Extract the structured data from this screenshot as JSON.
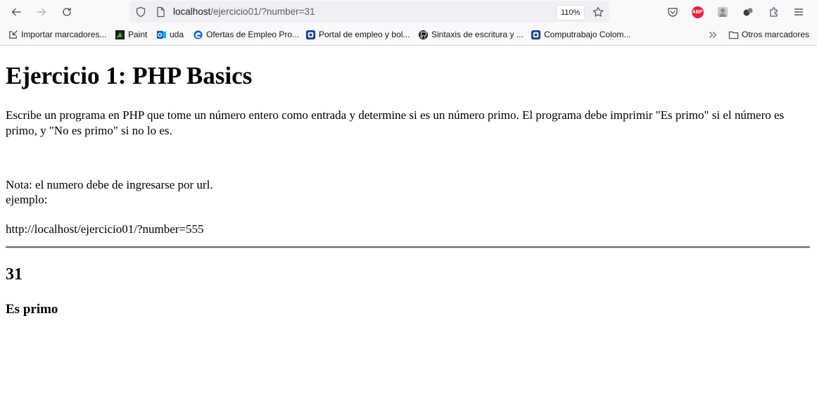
{
  "browser": {
    "url_host": "localhost",
    "url_path": "/ejercicio01/?number=31",
    "zoom": "110%"
  },
  "bookmarks": [
    {
      "label": "Importar marcadores...",
      "icon": "import-icon"
    },
    {
      "label": "Paint",
      "icon": "paint-icon"
    },
    {
      "label": "uda",
      "icon": "outlook-icon"
    },
    {
      "label": "Ofertas de Empleo Pro...",
      "icon": "edge-icon"
    },
    {
      "label": "Portal de empleo y bol...",
      "icon": "site-icon"
    },
    {
      "label": "Sintaxis de escritura y ...",
      "icon": "github-icon"
    },
    {
      "label": "Computrabajo Colom...",
      "icon": "site-icon"
    }
  ],
  "bookmarks_other": "Otros marcadores",
  "page": {
    "title": "Ejercicio 1: PHP Basics",
    "description": "Escribe un programa en PHP que tome un número entero como entrada y determine si es un número primo. El programa debe imprimir \"Es primo\" si el número es primo, y \"No es primo\" si no lo es.",
    "note_line1": "Nota: el numero debe de ingresarse por url.",
    "note_line2": "ejemplo:",
    "example_url": "http://localhost/ejercicio01/?number=555",
    "number": "31",
    "result": "Es primo"
  }
}
